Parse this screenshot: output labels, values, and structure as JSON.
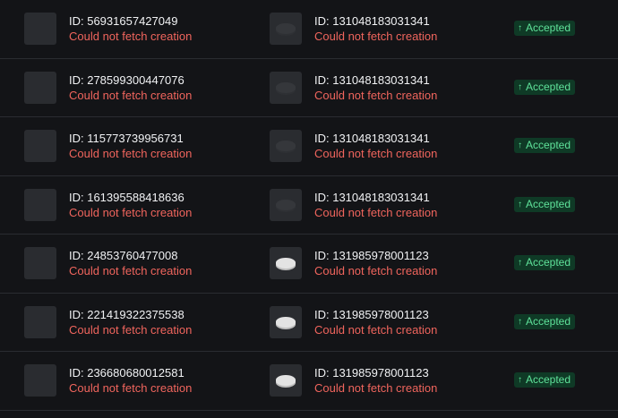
{
  "rows": [
    {
      "left_id": "ID: 56931657427049",
      "left_status": "Could not fetch creation",
      "right_id": "ID: 131048183031341",
      "right_status": "Could not fetch creation",
      "right_thumb": "dark",
      "badge": "Accepted"
    },
    {
      "left_id": "ID: 278599300447076",
      "left_status": "Could not fetch creation",
      "right_id": "ID: 131048183031341",
      "right_status": "Could not fetch creation",
      "right_thumb": "dark",
      "badge": "Accepted"
    },
    {
      "left_id": "ID: 115773739956731",
      "left_status": "Could not fetch creation",
      "right_id": "ID: 131048183031341",
      "right_status": "Could not fetch creation",
      "right_thumb": "dark",
      "badge": "Accepted"
    },
    {
      "left_id": "ID: 161395588418636",
      "left_status": "Could not fetch creation",
      "right_id": "ID: 131048183031341",
      "right_status": "Could not fetch creation",
      "right_thumb": "dark",
      "badge": "Accepted"
    },
    {
      "left_id": "ID: 24853760477008",
      "left_status": "Could not fetch creation",
      "right_id": "ID: 131985978001123",
      "right_status": "Could not fetch creation",
      "right_thumb": "light",
      "badge": "Accepted"
    },
    {
      "left_id": "ID: 221419322375538",
      "left_status": "Could not fetch creation",
      "right_id": "ID: 131985978001123",
      "right_status": "Could not fetch creation",
      "right_thumb": "light",
      "badge": "Accepted"
    },
    {
      "left_id": "ID: 236680680012581",
      "left_status": "Could not fetch creation",
      "right_id": "ID: 131985978001123",
      "right_status": "Could not fetch creation",
      "right_thumb": "light",
      "badge": "Accepted"
    }
  ],
  "icons": {
    "badge_icon": "arrow-up-icon",
    "thumb_icon": "puck-thumbnail-icon"
  },
  "colors": {
    "background": "#131417",
    "error_text": "#f0655d",
    "badge_bg": "#0f3a26",
    "badge_text": "#5fe29a"
  }
}
